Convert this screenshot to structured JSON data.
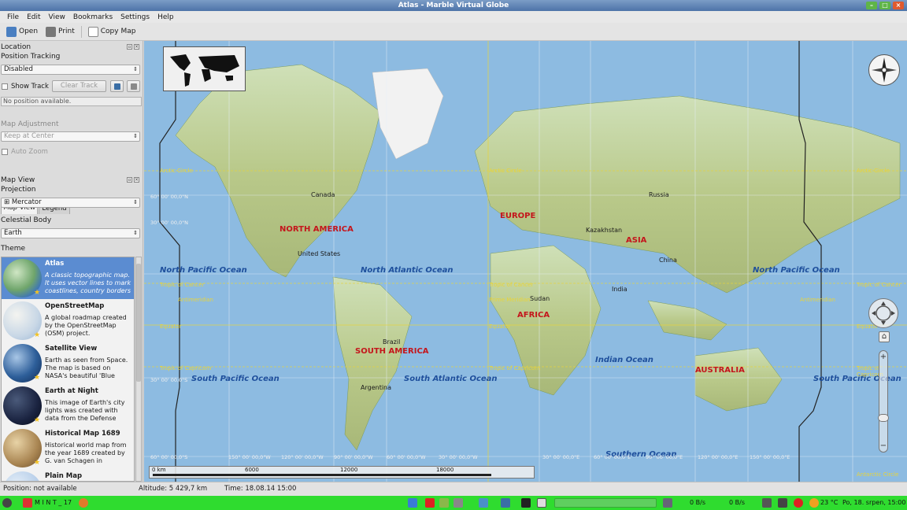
{
  "window": {
    "title": "Atlas - Marble Virtual Globe"
  },
  "menu": [
    "File",
    "Edit",
    "View",
    "Bookmarks",
    "Settings",
    "Help"
  ],
  "toolbar": {
    "open": "Open",
    "print": "Print",
    "copy_map": "Copy Map"
  },
  "location": {
    "title": "Location",
    "position_tracking_label": "Position Tracking",
    "position_tracking_value": "Disabled",
    "show_track": "Show Track",
    "clear_track": "Clear Track",
    "status": "No position available."
  },
  "map_adjustment": {
    "title": "Map Adjustment",
    "keep_at": "Keep at Center",
    "auto_zoom": "Auto Zoom"
  },
  "tabs": {
    "map_view": "Map View",
    "legend": "Legend"
  },
  "map_view": {
    "title": "Map View",
    "projection_label": "Projection",
    "projection_value": "Mercator",
    "celestial_label": "Celestial Body",
    "celestial_value": "Earth",
    "theme_label": "Theme"
  },
  "themes": [
    {
      "title": "Atlas",
      "desc": "A classic topographic map. It uses vector lines to mark coastlines, country borders"
    },
    {
      "title": "OpenStreetMap",
      "desc": "A global roadmap created by the OpenStreetMap (OSM) project."
    },
    {
      "title": "Satellite View",
      "desc": "Earth as seen from Space. The map is based on NASA's beautiful 'Blue"
    },
    {
      "title": "Earth at Night",
      "desc": "This image of Earth's city lights was created with data from the Defense"
    },
    {
      "title": "Historical Map 1689",
      "desc": "Historical world map from the year 1689 created by G. van Schagen in"
    },
    {
      "title": "Plain Map",
      "desc": ""
    }
  ],
  "map": {
    "oceans": [
      "North Pacific Ocean",
      "North Atlantic Ocean",
      "North Pacific Ocean",
      "South Pacific Ocean",
      "South Atlantic Ocean",
      "Indian Ocean",
      "South Pacific Ocean",
      "Southern Ocean"
    ],
    "continents": [
      "NORTH AMERICA",
      "EUROPE",
      "ASIA",
      "AFRICA",
      "SOUTH AMERICA",
      "AUSTRALIA"
    ],
    "countries": [
      "Canada",
      "Russia",
      "United States",
      "Kazakhstan",
      "China",
      "India",
      "Sudan",
      "Brazil",
      "Argentina"
    ],
    "geo_lines": [
      "Arctic Circle",
      "Arctic Circle",
      "Arctic Circle",
      "Tropic of Cancer",
      "Tropic of Cancer",
      "Tropic of Cancer",
      "Antimeridian",
      "Prime Meridian",
      "Antimeridian",
      "Equator",
      "Equator",
      "Equator",
      "Tropic of Capricorn",
      "Tropic of Capricorn",
      "Tropic of Capricorn",
      "Antarctic Circle"
    ],
    "coords_left": [
      "60° 00' 00,0\"N",
      "30° 00' 00,0\"N",
      "30° 00' 00,0\"S",
      "60° 00' 00,0\"S"
    ],
    "coords_bottom": [
      "150° 00' 00,0\"W",
      "120° 00' 00,0\"W",
      "90° 00' 00,0\"W",
      "60° 00' 00,0\"W",
      "30° 00' 00,0\"W",
      "30° 00' 00,0\"E",
      "60° 00' 00,0\"E",
      "90° 00' 00,0\"E",
      "120° 00' 00,0\"E",
      "150° 00' 00,0\"E"
    ],
    "scale": [
      "0 km",
      "6000",
      "12000",
      "18000"
    ]
  },
  "status": {
    "position": "Position: not available",
    "altitude": "Altitude:  5 429,7 km",
    "time": "Time: 18.08.14 15:00"
  },
  "taskbar": {
    "start": "M I N T _ 17",
    "net_down": "0 B/s",
    "net_up": "0 B/s",
    "temp": "23 °C",
    "datetime": "Po, 18. srpen, 15:00"
  },
  "colors": {
    "selection": "#5b8cd1",
    "taskbar": "#2fdc2f",
    "continent_label": "#c4161c",
    "ocean_label": "#1e4f9c"
  }
}
